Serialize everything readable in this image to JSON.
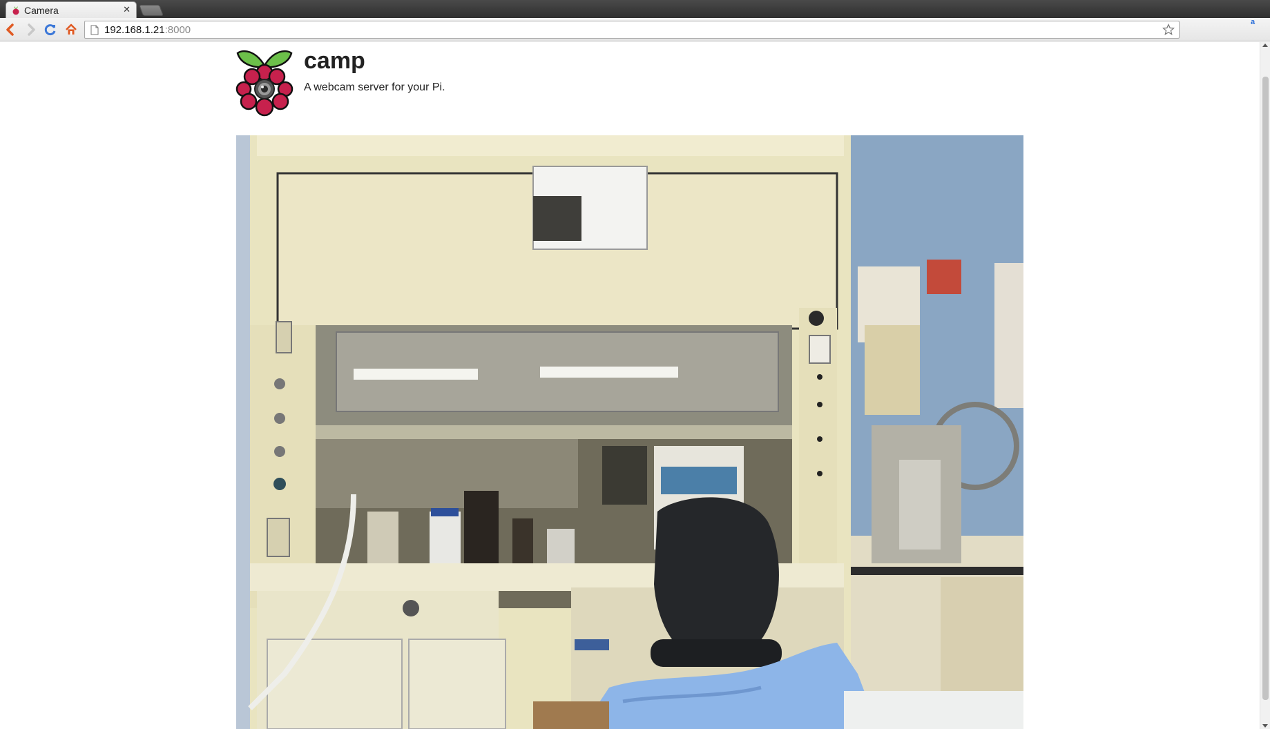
{
  "browser": {
    "tab": {
      "title": "Camera"
    },
    "address": {
      "host": "192.168.1.21",
      "port": ":8000"
    }
  },
  "page": {
    "title": "camp",
    "tagline": "A webcam server for your Pi.",
    "feed": {
      "alt": "Live webcam stream"
    }
  },
  "icons": {
    "back": "arrow-left-icon",
    "forward": "arrow-right-icon",
    "reload": "reload-icon",
    "home": "home-icon",
    "bookmark": "star-icon",
    "menu": "hamburger-menu-icon",
    "logo": "raspberry-pi-logo"
  },
  "colors": {
    "accent_red": "#c7214d",
    "leaf_green": "#6cc04a",
    "nav_orange": "#e05a23",
    "reload_blue": "#3c78d8"
  }
}
